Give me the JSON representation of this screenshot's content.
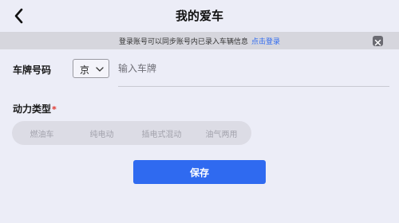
{
  "header": {
    "title": "我的爱车",
    "back_icon": "chevron-left-icon"
  },
  "banner": {
    "text": "登录账号可以同步账号内已录入车辆信息",
    "link": "点击登录",
    "close_icon": "close-icon"
  },
  "plate": {
    "label": "车牌号码",
    "province": "京",
    "province_icon": "chevron-down-icon",
    "placeholder": "输入车牌",
    "value": ""
  },
  "power": {
    "label": "动力类型",
    "required_mark": "*",
    "options": [
      "燃油车",
      "纯电动",
      "插电式混动",
      "油气两用"
    ]
  },
  "save": {
    "label": "保存"
  },
  "colors": {
    "background": "#ecedf7",
    "accent": "#2f6af0",
    "banner": "#d6d6dd",
    "required": "#e0342c"
  }
}
